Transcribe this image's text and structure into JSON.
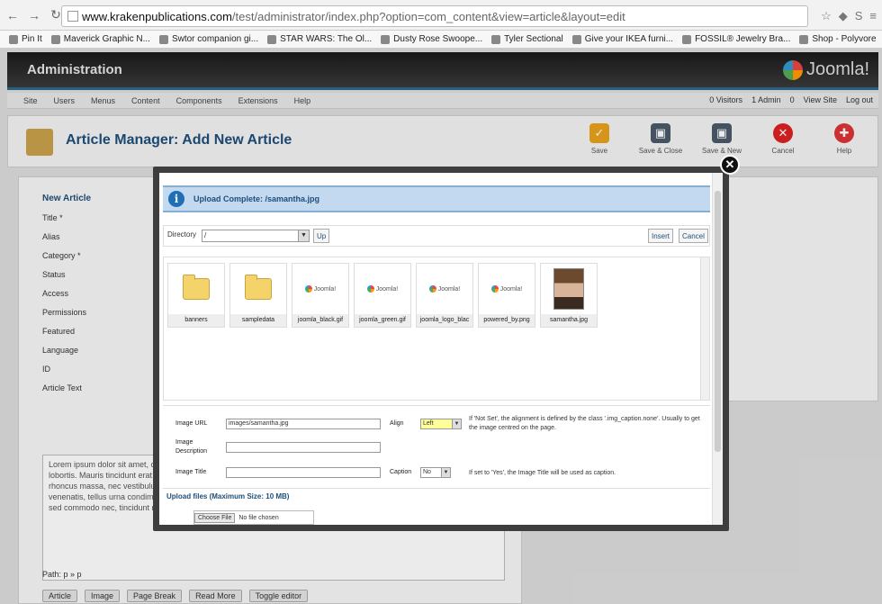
{
  "browser": {
    "url_host": "www.krakenpublications.com",
    "url_path": "/test/administrator/index.php?option=com_content&view=article&layout=edit",
    "bookmarks": [
      "Pin It",
      "Maverick Graphic N...",
      "Swtor companion gi...",
      "STAR WARS: The Ol...",
      "Dusty Rose Swoope...",
      "Tyler Sectional",
      "Give your IKEA furni...",
      "FOSSIL® Jewelry Bra...",
      "Shop - Polyvore"
    ]
  },
  "admin": {
    "title": "Administration",
    "brand": "Joomla!",
    "menu": [
      "Site",
      "Users",
      "Menus",
      "Content",
      "Components",
      "Extensions",
      "Help"
    ],
    "status": [
      "0 Visitors",
      "1 Admin",
      "0",
      "View Site",
      "Log out"
    ],
    "page_title": "Article Manager: Add New Article",
    "toolbar": [
      "Save",
      "Save & Close",
      "Save & New",
      "Cancel",
      "Help"
    ],
    "form_heading": "New Article",
    "form_labels": [
      "Title *",
      "Alias",
      "Category *",
      "Status",
      "Access",
      "Permissions",
      "Featured",
      "Language",
      "ID",
      "Article Text"
    ],
    "editor_text": "Lorem ipsum dolor sit amet, consectetur adipiscing elit. Nam ut ... amet justo tempor dictum ... sollicitudin porta. Morbi quis ... lobortis. Mauris tincidunt erat non ... amet ut mauris. Donec et ... ullamcorper vel pharetra nisi malesuada. Nam mollis rhoncus massa, nec vestibulum elit aliquet id. Phasellus congue molestie sodales. Cras vulputate, lorem non rhoncus venenatis, tellus urna condimentum ipsum, vitae dapibus ante risus id ligula. Etiam eu sagittis magna. Cras nisi nisi, placerat sed commodo nec, tincidunt non est. Pellentesque",
    "editor_path": "Path: p » p",
    "editor_buttons": [
      "Article",
      "Image",
      "Page Break",
      "Read More",
      "Toggle editor"
    ]
  },
  "modal": {
    "message": "Upload Complete: /samantha.jpg",
    "directory_label": "Directory",
    "directory_value": "/",
    "up_label": "Up",
    "insert_label": "Insert",
    "cancel_label": "Cancel",
    "files": [
      {
        "name": "banners",
        "kind": "folder"
      },
      {
        "name": "sampledata",
        "kind": "folder"
      },
      {
        "name": "joomla_black.gif",
        "kind": "logo"
      },
      {
        "name": "joomla_green.gif",
        "kind": "logo"
      },
      {
        "name": "joomla_logo_blac",
        "kind": "logo"
      },
      {
        "name": "powered_by.png",
        "kind": "logo"
      },
      {
        "name": "samantha.jpg",
        "kind": "photo"
      }
    ],
    "image_url_label": "Image URL",
    "image_url_value": "images/samantha.jpg",
    "align_label": "Align",
    "align_value": "Left",
    "align_help": "If 'Not Set', the alignment is defined by the class '.img_caption.none'. Usually to get the image centred on the page.",
    "description_label": "Image Description",
    "title_label": "Image Title",
    "caption_label": "Caption",
    "caption_value": "No",
    "caption_help": "If set to 'Yes', the Image Title will be used as caption.",
    "upload_title": "Upload files (Maximum Size: 10 MB)",
    "choose_file": "Choose File",
    "no_file": "No file chosen"
  }
}
